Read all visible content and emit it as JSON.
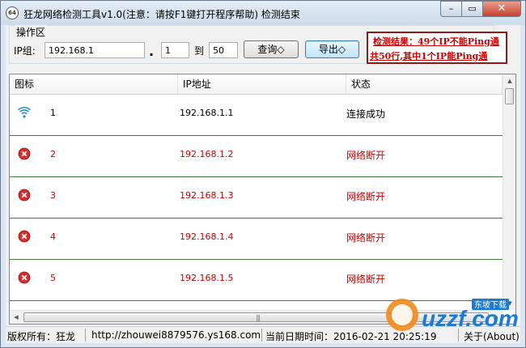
{
  "window": {
    "title": "狂龙网络检测工具v1.0(注意：请按F1键打开程序帮助)  检测结束",
    "app_icon_text": "64",
    "minimize_glyph": "–",
    "maximize_glyph": "▭",
    "close_glyph": "✕"
  },
  "ops": {
    "group_label": "操作区",
    "ip_group_label": "IP组:",
    "ip_prefix_value": "192.168.1",
    "dot": ".",
    "start_value": "1",
    "to_label": "到",
    "end_value": "50",
    "query_button": "查询◇",
    "export_button": "导出◇"
  },
  "result": {
    "line1": "检测结果：49个IP不能Ping通",
    "line2": "共50行,其中1个IP能Ping通"
  },
  "table": {
    "columns": [
      "图标",
      "IP地址",
      "状态"
    ],
    "rows": [
      {
        "icon": "wifi-signal-icon",
        "num": "1",
        "ip": "192.168.1.1",
        "status": "连接成功",
        "color": "#000000"
      },
      {
        "icon": "error-icon",
        "num": "2",
        "ip": "192.168.1.2",
        "status": "网络断开",
        "color": "#cc0000"
      },
      {
        "icon": "error-icon",
        "num": "3",
        "ip": "192.168.1.3",
        "status": "网络断开",
        "color": "#cc0000"
      },
      {
        "icon": "error-icon",
        "num": "4",
        "ip": "192.168.1.4",
        "status": "网络断开",
        "color": "#cc0000"
      },
      {
        "icon": "error-icon",
        "num": "5",
        "ip": "192.168.1.5",
        "status": "网络断开",
        "color": "#cc0000"
      }
    ]
  },
  "statusbar": {
    "copyright": "版权所有：狂龙",
    "url": "http://zhouwei8879576.ys168.com",
    "datetime": "当前日期时间：2016-02-21 20:25:19",
    "about": "关于(About)"
  },
  "watermark": {
    "brand": "uzzf.com",
    "tag": "东坡下载"
  },
  "colors": {
    "error": "#cc0000",
    "success": "#000000",
    "wifi": "#1a8fd6",
    "row_divider": "#3a7a3a",
    "result_border": "#8b1a1a"
  }
}
